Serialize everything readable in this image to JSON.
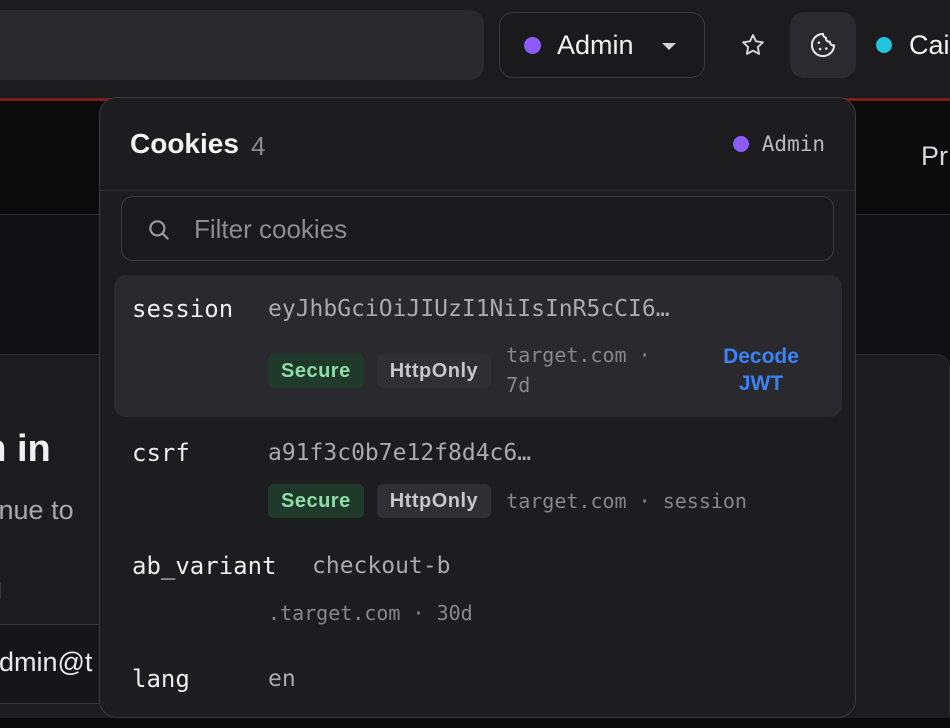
{
  "toolbar": {
    "profile_label": "Admin",
    "profile_color": "#8b5cf6",
    "env_label": "Cai",
    "env_color": "#22c4dc",
    "icons": [
      "star-icon",
      "cookie-icon",
      "chevron-down-icon"
    ]
  },
  "page": {
    "nav_partial": "Pr",
    "signin_title": "gn in",
    "signin_subtitle": "ntinue to",
    "email_label": "il",
    "email_value": "dmin@t"
  },
  "popover": {
    "title": "Cookies",
    "count": "4",
    "profile_label": "Admin",
    "profile_color": "#8b5cf6",
    "filter_placeholder": "Filter cookies",
    "decode_label": "Decode JWT",
    "cookies": [
      {
        "name": "session",
        "value": "eyJhbGciOiJIUzI1NiIsInR5cCI6…",
        "badges": [
          "Secure",
          "HttpOnly"
        ],
        "meta": "target.com · 7d"
      },
      {
        "name": "csrf",
        "value": "a91f3c0b7e12f8d4c6…",
        "badges": [
          "Secure",
          "HttpOnly"
        ],
        "meta": "target.com · session"
      },
      {
        "name": "ab_variant",
        "value": "checkout-b",
        "badges": [],
        "meta": ".target.com · 30d"
      },
      {
        "name": "lang",
        "value": "en",
        "badges": [],
        "meta": ""
      }
    ]
  }
}
